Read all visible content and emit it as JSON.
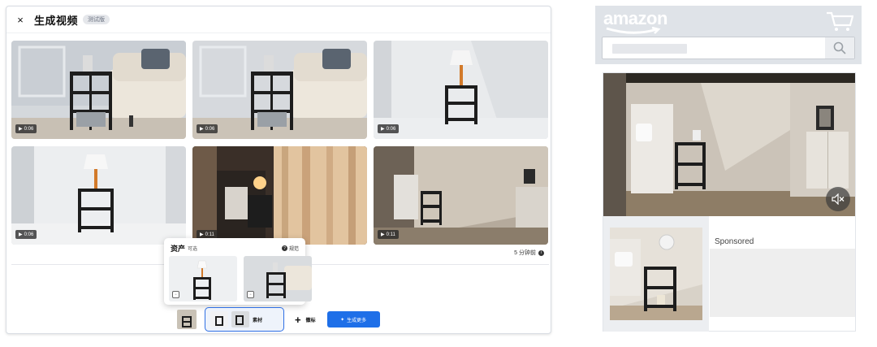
{
  "editor": {
    "close_glyph": "×",
    "title": "生成视频",
    "beta_badge": "测试版",
    "videos": [
      {
        "duration": "0:06",
        "scene": "living-room-sofa"
      },
      {
        "duration": "0:06",
        "scene": "living-room-sofa"
      },
      {
        "duration": "0:06",
        "scene": "white-wall-lamp"
      },
      {
        "duration": "0:06",
        "scene": "white-room-lamp"
      },
      {
        "duration": "0:11",
        "scene": "bedroom-curtain"
      },
      {
        "duration": "0:11",
        "scene": "bedroom-sunlight"
      }
    ],
    "timestamp": "5 分钟前",
    "assets_panel": {
      "title": "资产",
      "subtitle": "可选",
      "spec_label": "规范"
    },
    "bottom_bar": {
      "materials_label": "素材",
      "add_glyph": "+",
      "mark_label": "徽标",
      "generate_label": "生成更多",
      "generate_glyph": "✦"
    }
  },
  "preview": {
    "logo": "amazon",
    "sponsored_label": "Sponsored"
  },
  "colors": {
    "accent": "#1e6fe8",
    "amazon_header_bg": "#dfe3e8"
  }
}
